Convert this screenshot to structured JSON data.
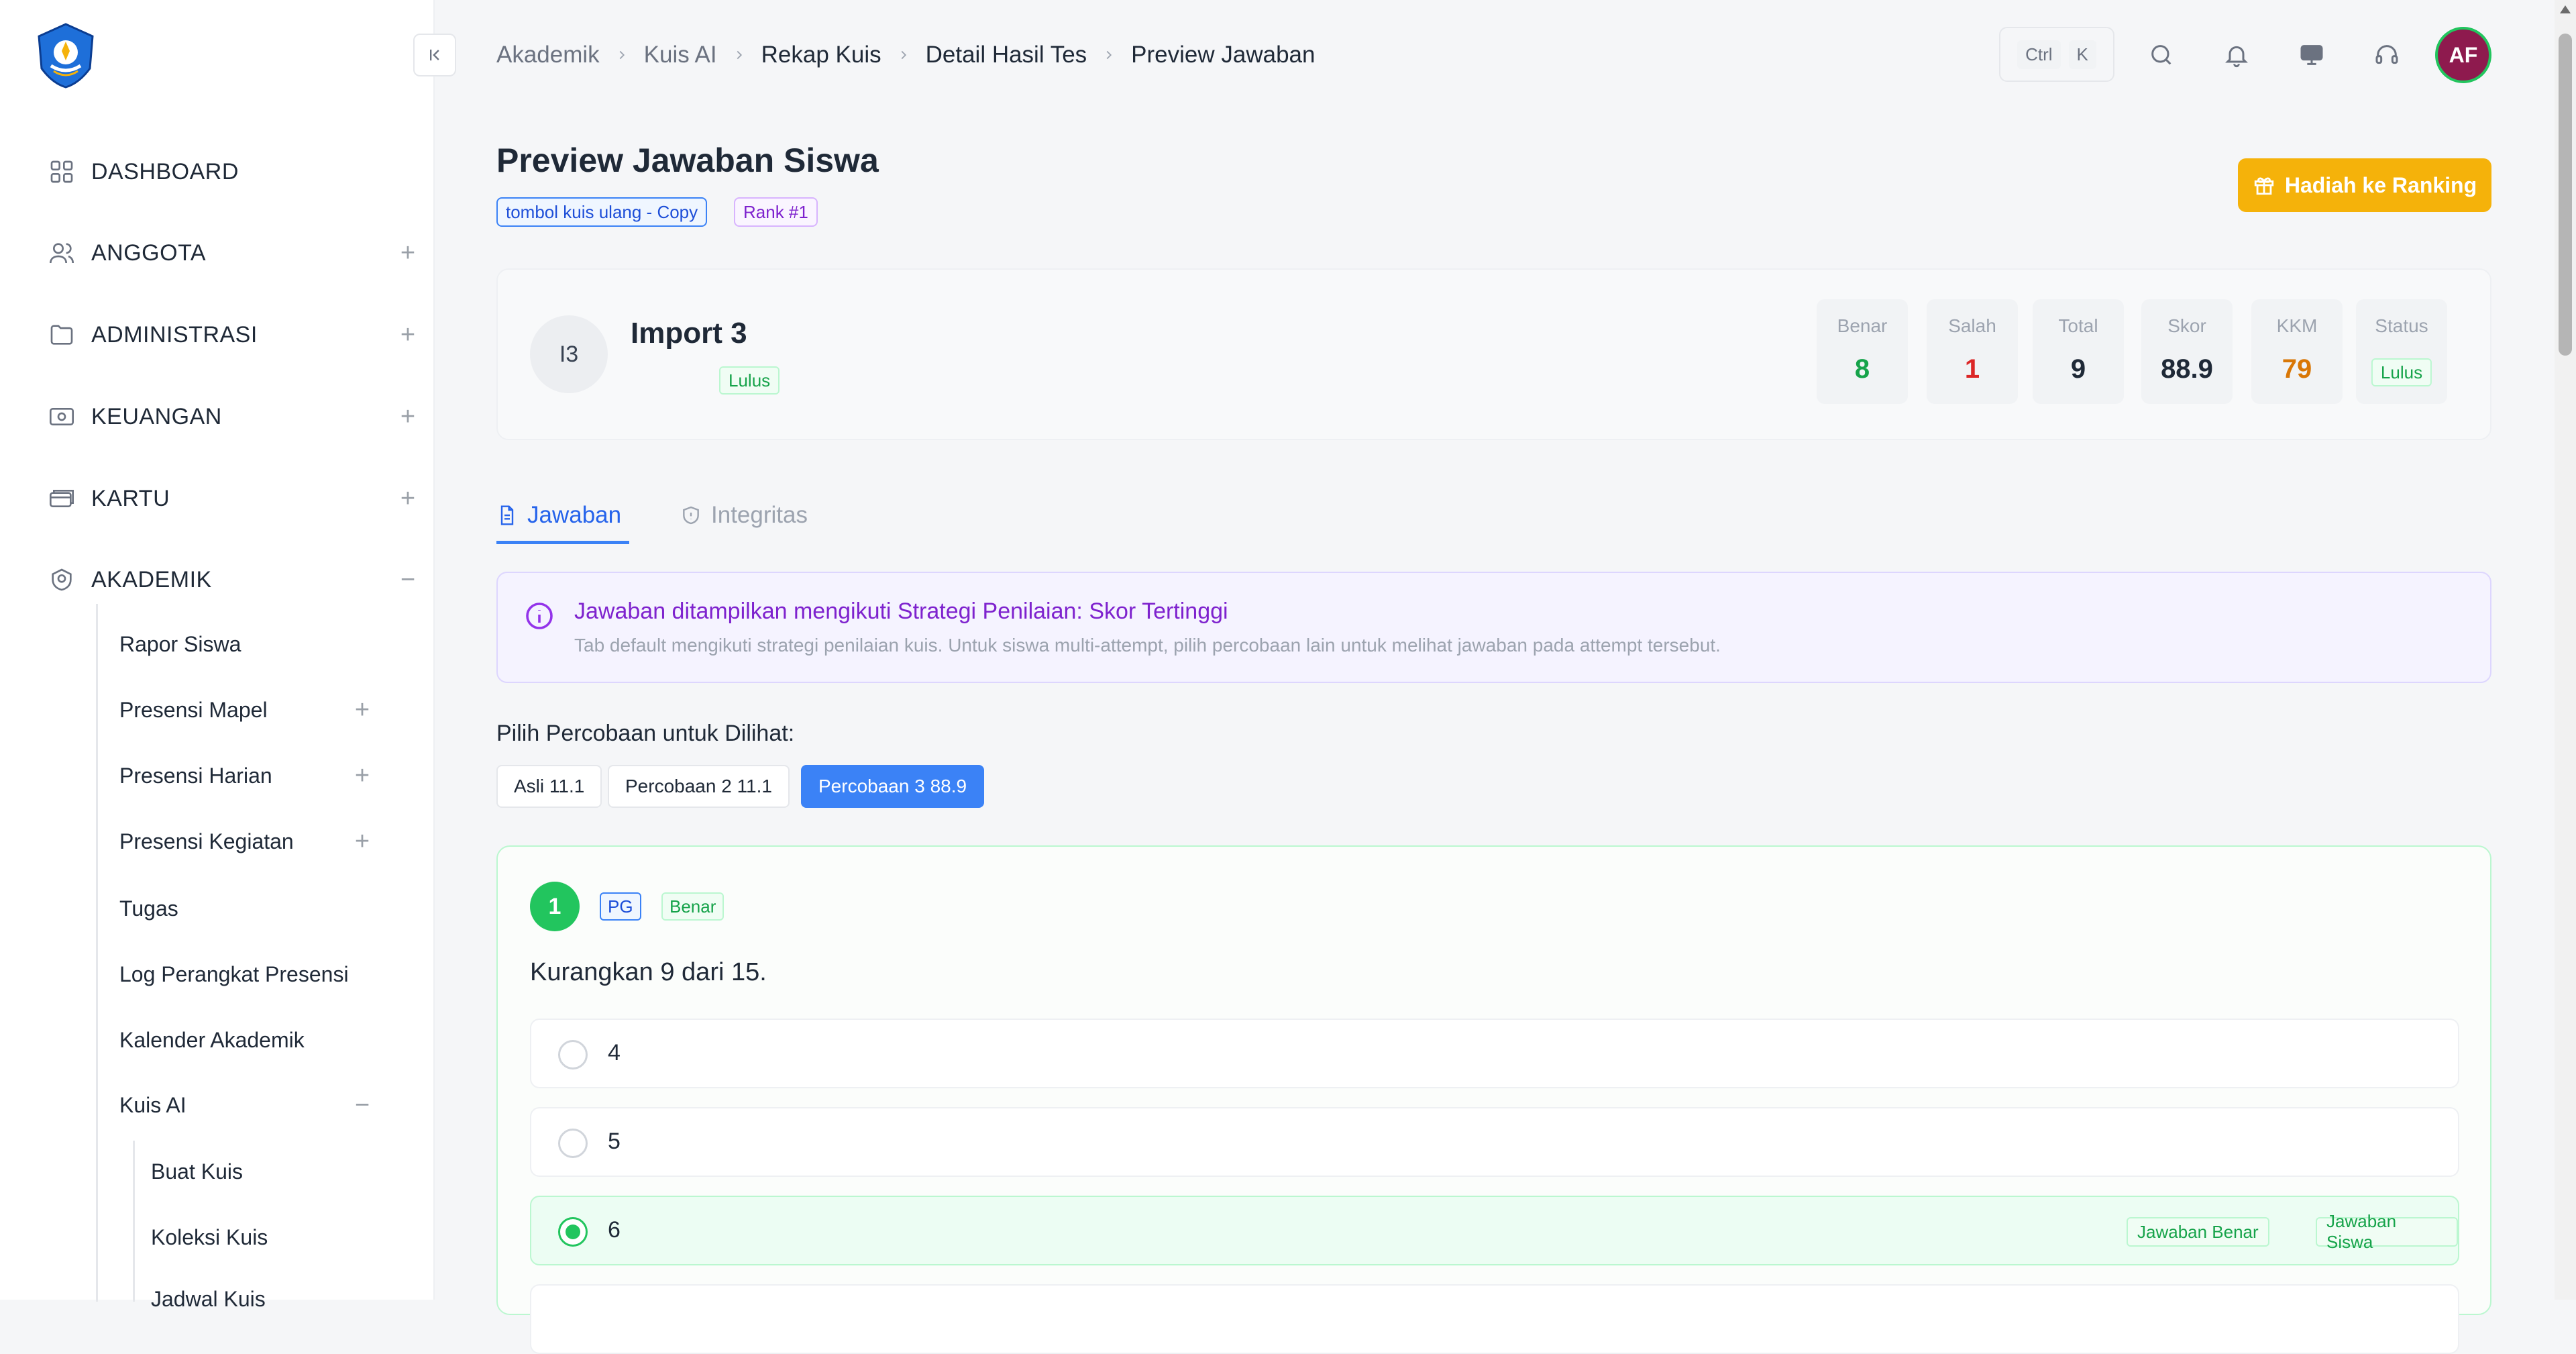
{
  "breadcrumb": [
    "Akademik",
    "Kuis AI",
    "Rekap Kuis",
    "Detail Hasil Tes",
    "Preview Jawaban"
  ],
  "shortcut": {
    "ctrl": "Ctrl",
    "key": "K"
  },
  "user": {
    "initials": "AF"
  },
  "sidebar": {
    "items": [
      {
        "label": "DASHBOARD",
        "icon": "grid-icon"
      },
      {
        "label": "ANGGOTA",
        "icon": "users-icon",
        "toggle": "+"
      },
      {
        "label": "ADMINISTRASI",
        "icon": "folder-icon",
        "toggle": "+"
      },
      {
        "label": "KEUANGAN",
        "icon": "money-icon",
        "toggle": "+"
      },
      {
        "label": "KARTU",
        "icon": "card-icon",
        "toggle": "+"
      },
      {
        "label": "AKADEMIK",
        "icon": "academic-icon",
        "toggle": "−"
      }
    ],
    "akademik_sub": [
      {
        "label": "Rapor Siswa"
      },
      {
        "label": "Presensi Mapel",
        "toggle": "+"
      },
      {
        "label": "Presensi Harian",
        "toggle": "+"
      },
      {
        "label": "Presensi Kegiatan",
        "toggle": "+"
      },
      {
        "label": "Tugas"
      },
      {
        "label": "Log Perangkat Presensi"
      },
      {
        "label": "Kalender Akademik"
      },
      {
        "label": "Kuis AI",
        "toggle": "−"
      }
    ],
    "kuis_sub": [
      "Buat Kuis",
      "Koleksi Kuis",
      "Jadwal Kuis"
    ]
  },
  "page": {
    "title": "Preview Jawaban Siswa",
    "tag_quiz": "tombol kuis ulang - Copy",
    "tag_rank": "Rank #1",
    "reward_button": "Hadiah ke Ranking"
  },
  "student": {
    "initials": "I3",
    "name": "Import 3",
    "status_badge": "Lulus",
    "stats": [
      {
        "label": "Benar",
        "value": "8",
        "color": "#16a34a"
      },
      {
        "label": "Salah",
        "value": "1",
        "color": "#dc2626"
      },
      {
        "label": "Total",
        "value": "9",
        "color": "#1f2937"
      },
      {
        "label": "Skor",
        "value": "88.9",
        "color": "#1f2937"
      },
      {
        "label": "KKM",
        "value": "79",
        "color": "#d97706"
      }
    ],
    "status_label": "Status",
    "status_value": "Lulus"
  },
  "tabs": [
    {
      "label": "Jawaban",
      "icon": "document-icon",
      "active": true
    },
    {
      "label": "Integritas",
      "icon": "shield-icon",
      "active": false
    }
  ],
  "info": {
    "title": "Jawaban ditampilkan mengikuti Strategi Penilaian: Skor Tertinggi",
    "desc": "Tab default mengikuti strategi penilaian kuis. Untuk siswa multi-attempt, pilih percobaan lain untuk melihat jawaban pada attempt tersebut."
  },
  "attempts": {
    "label": "Pilih Percobaan untuk Dilihat:",
    "options": [
      "Asli 11.1",
      "Percobaan 2 11.1",
      "Percobaan 3 88.9"
    ],
    "selected": 2
  },
  "question": {
    "number": "1",
    "type": "PG",
    "result": "Benar",
    "text": "Kurangkan 9 dari 15.",
    "options": [
      {
        "text": "4"
      },
      {
        "text": "5"
      },
      {
        "text": "6",
        "correct": true,
        "selected": true,
        "badges": [
          "Jawaban Benar",
          "Jawaban Siswa"
        ]
      }
    ]
  },
  "colors": {
    "primary": "#3b82f6",
    "success": "#22c55e",
    "warning": "#f5b20a",
    "purple": "#7e22ce"
  }
}
